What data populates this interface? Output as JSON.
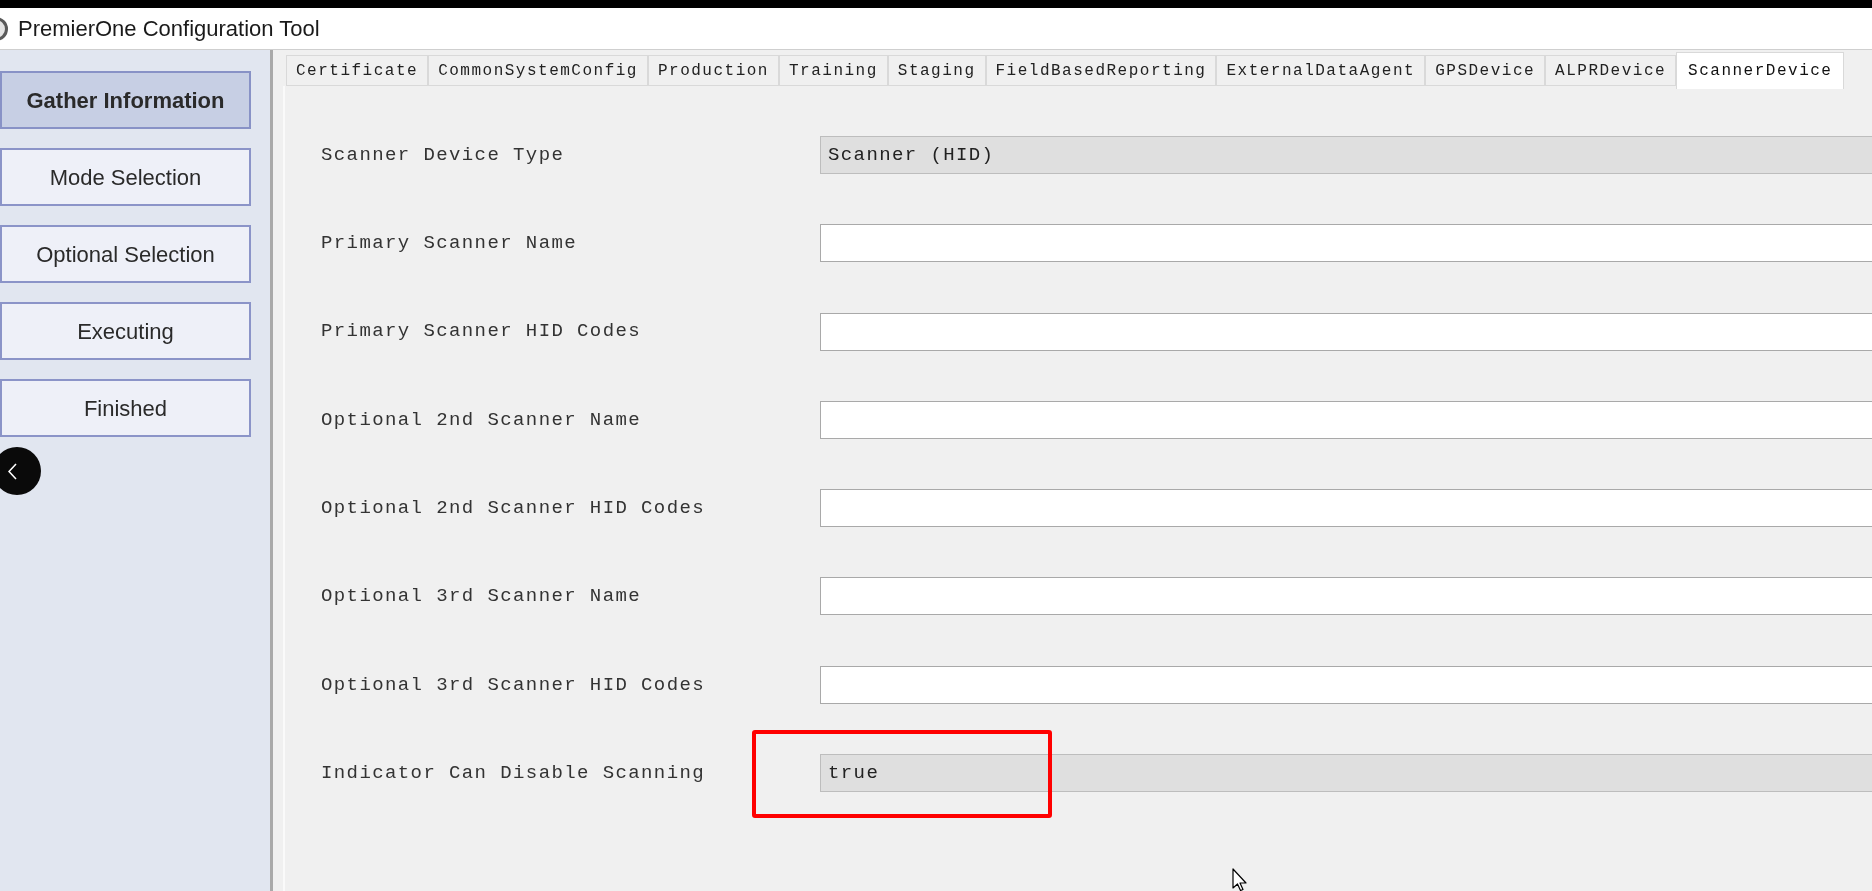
{
  "window": {
    "title": "PremierOne Configuration Tool"
  },
  "sidebar": {
    "steps": [
      {
        "label": "Gather Information",
        "selected": true
      },
      {
        "label": "Mode Selection",
        "selected": false
      },
      {
        "label": "Optional Selection",
        "selected": false
      },
      {
        "label": "Executing",
        "selected": false
      },
      {
        "label": "Finished",
        "selected": false
      }
    ]
  },
  "tabs": [
    {
      "label": "Certificate",
      "selected": false
    },
    {
      "label": "CommonSystemConfig",
      "selected": false
    },
    {
      "label": "Production",
      "selected": false
    },
    {
      "label": "Training",
      "selected": false
    },
    {
      "label": "Staging",
      "selected": false
    },
    {
      "label": "FieldBasedReporting",
      "selected": false
    },
    {
      "label": "ExternalDataAgent",
      "selected": false
    },
    {
      "label": "GPSDevice",
      "selected": false
    },
    {
      "label": "ALPRDevice",
      "selected": false
    },
    {
      "label": "ScannerDevice",
      "selected": true
    }
  ],
  "form": {
    "fields": [
      {
        "label": "Scanner Device Type",
        "value": "Scanner (HID)",
        "disabled": true,
        "highlighted": false
      },
      {
        "label": "Primary Scanner Name",
        "disabled": false,
        "highlighted": false
      },
      {
        "label": "Primary Scanner HID Codes",
        "disabled": false,
        "highlighted": false
      },
      {
        "label": "Optional 2nd Scanner Name",
        "disabled": false,
        "highlighted": false
      },
      {
        "label": "Optional 2nd Scanner HID Codes",
        "disabled": false,
        "highlighted": false
      },
      {
        "label": "Optional 3rd Scanner Name",
        "disabled": false,
        "highlighted": false
      },
      {
        "label": "Optional 3rd Scanner HID Codes",
        "disabled": false,
        "highlighted": false
      },
      {
        "label": "Indicator Can Disable Scanning",
        "value": "true",
        "disabled": true,
        "highlighted": true
      }
    ]
  }
}
